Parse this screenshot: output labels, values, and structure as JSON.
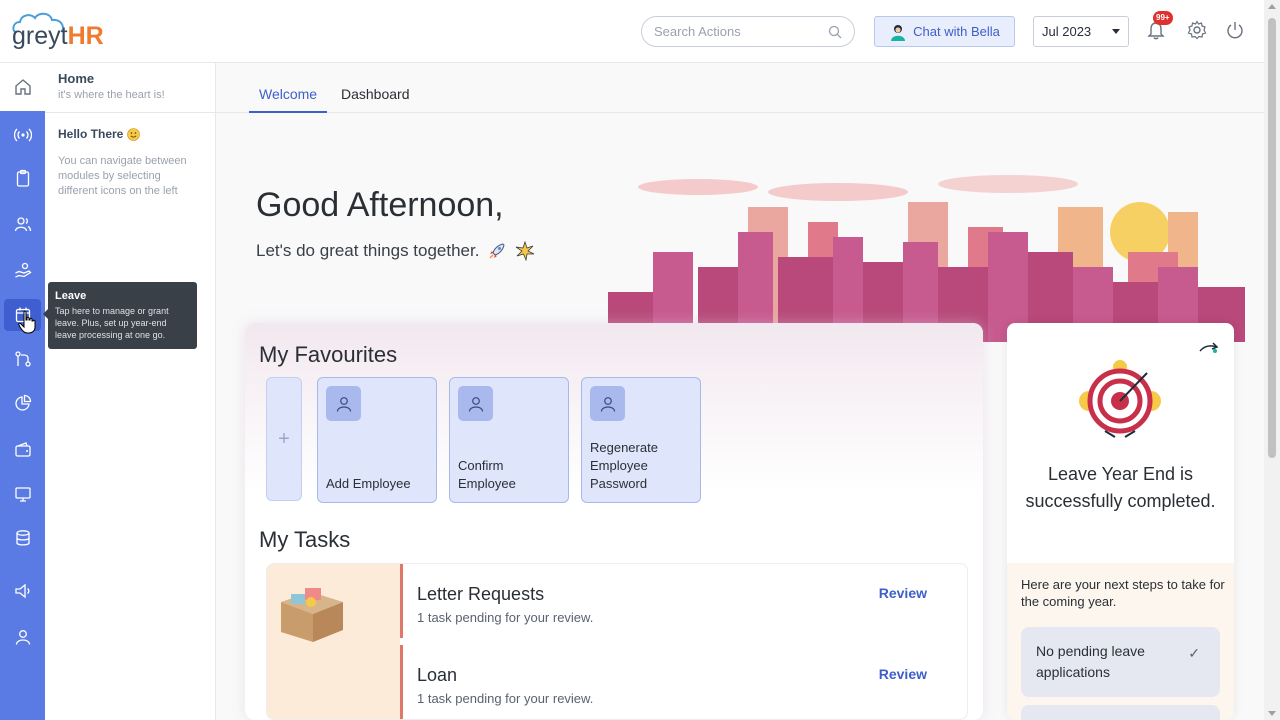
{
  "brand": {
    "logo_prefix": "greyt",
    "logo_suffix": "HR",
    "accent": "#5b7be4",
    "logo_accent": "#f07a2e"
  },
  "topbar": {
    "search_placeholder": "Search Actions",
    "chat_label": "Chat with Bella",
    "month": "Jul 2023",
    "notification_count": "99+"
  },
  "panel": {
    "title": "Home",
    "subtitle": "it's where the heart is!",
    "hello_title": "Hello There",
    "hello_text": "You can navigate between modules by selecting different icons on the left"
  },
  "tooltip": {
    "title": "Leave",
    "text": "Tap here to manage or grant leave. Plus, set up year-end leave processing at one go."
  },
  "tabs": [
    {
      "label": "Welcome",
      "active": true
    },
    {
      "label": "Dashboard",
      "active": false
    }
  ],
  "greeting": {
    "title": "Good Afternoon,",
    "subtitle": "Let's do great things together."
  },
  "favourites": {
    "title": "My Favourites",
    "add_label": "+",
    "items": [
      {
        "label": "Add Employee"
      },
      {
        "label": "Confirm Employee"
      },
      {
        "label": "Regenerate Employee Password"
      }
    ]
  },
  "tasks": {
    "title": "My Tasks",
    "items": [
      {
        "name": "Letter Requests",
        "sub": "1 task pending for your review.",
        "action": "Review"
      },
      {
        "name": "Loan",
        "sub": "1 task pending for your review.",
        "action": "Review"
      }
    ]
  },
  "leave_year_end": {
    "title": "Leave Year End is successfully completed.",
    "note": "Here are your next steps to take for the coming year.",
    "steps": [
      {
        "label": "No pending leave applications",
        "done": true
      }
    ]
  }
}
